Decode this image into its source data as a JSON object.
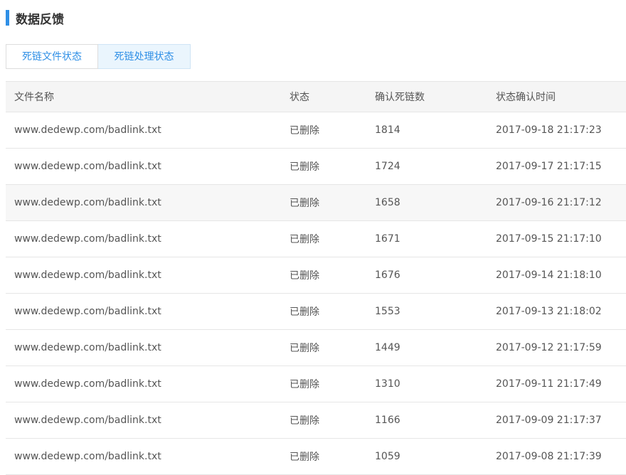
{
  "section": {
    "title": "数据反馈"
  },
  "tabs": [
    {
      "label": "死链文件状态",
      "active": false
    },
    {
      "label": "死链处理状态",
      "active": true
    }
  ],
  "table": {
    "headers": [
      "文件名称",
      "状态",
      "确认死链数",
      "状态确认时间"
    ],
    "rows": [
      [
        "www.dedewp.com/badlink.txt",
        "已删除",
        "1814",
        "2017-09-18 21:17:23"
      ],
      [
        "www.dedewp.com/badlink.txt",
        "已删除",
        "1724",
        "2017-09-17 21:17:15"
      ],
      [
        "www.dedewp.com/badlink.txt",
        "已删除",
        "1658",
        "2017-09-16 21:17:12"
      ],
      [
        "www.dedewp.com/badlink.txt",
        "已删除",
        "1671",
        "2017-09-15 21:17:10"
      ],
      [
        "www.dedewp.com/badlink.txt",
        "已删除",
        "1676",
        "2017-09-14 21:18:10"
      ],
      [
        "www.dedewp.com/badlink.txt",
        "已删除",
        "1553",
        "2017-09-13 21:18:02"
      ],
      [
        "www.dedewp.com/badlink.txt",
        "已删除",
        "1449",
        "2017-09-12 21:17:59"
      ],
      [
        "www.dedewp.com/badlink.txt",
        "已删除",
        "1310",
        "2017-09-11 21:17:49"
      ],
      [
        "www.dedewp.com/badlink.txt",
        "已删除",
        "1166",
        "2017-09-09 21:17:37"
      ],
      [
        "www.dedewp.com/badlink.txt",
        "已删除",
        "1059",
        "2017-09-08 21:17:39"
      ]
    ]
  },
  "colors": {
    "accent": "#2f8fe6",
    "header_bg": "#f5f5f5",
    "active_tab_bg": "#eaf5fd"
  }
}
